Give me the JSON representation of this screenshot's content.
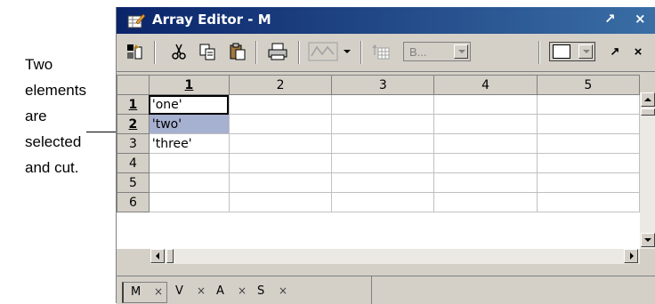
{
  "callout": {
    "lines": [
      "Two",
      "elements",
      "are",
      "selected",
      "and cut."
    ]
  },
  "window": {
    "title": "Array Editor - M",
    "undock_glyph": "↗",
    "close_glyph": "×"
  },
  "toolbar": {
    "icons": [
      "import-data-icon",
      "cut-icon",
      "copy-icon",
      "paste-icon",
      "print-icon",
      "plot-icon",
      "plot-dropdown-icon",
      "transpose-icon"
    ],
    "base_combo": "B...",
    "dock_undock_glyph": "↗",
    "close_glyph": "×"
  },
  "grid": {
    "columns": [
      "1",
      "2",
      "3",
      "4",
      "5"
    ],
    "rows": [
      {
        "label": "1",
        "cells": [
          "'one'",
          "",
          "",
          "",
          ""
        ]
      },
      {
        "label": "2",
        "cells": [
          "'two'",
          "",
          "",
          "",
          ""
        ]
      },
      {
        "label": "3",
        "cells": [
          "'three'",
          "",
          "",
          "",
          ""
        ]
      },
      {
        "label": "4",
        "cells": [
          "",
          "",
          "",
          "",
          ""
        ]
      },
      {
        "label": "5",
        "cells": [
          "",
          "",
          "",
          "",
          ""
        ]
      },
      {
        "label": "6",
        "cells": [
          "",
          "",
          "",
          "",
          ""
        ]
      }
    ]
  },
  "tabs": [
    {
      "name": "M",
      "close": "×"
    },
    {
      "name": "V",
      "close": "×"
    },
    {
      "name": "A",
      "close": "×"
    },
    {
      "name": "S",
      "close": "×"
    }
  ],
  "colors": {
    "titlebar_start": "#0a246a",
    "titlebar_end": "#3a6ea5",
    "selection": "#a6b0d0",
    "chrome": "#d4d0c8"
  }
}
